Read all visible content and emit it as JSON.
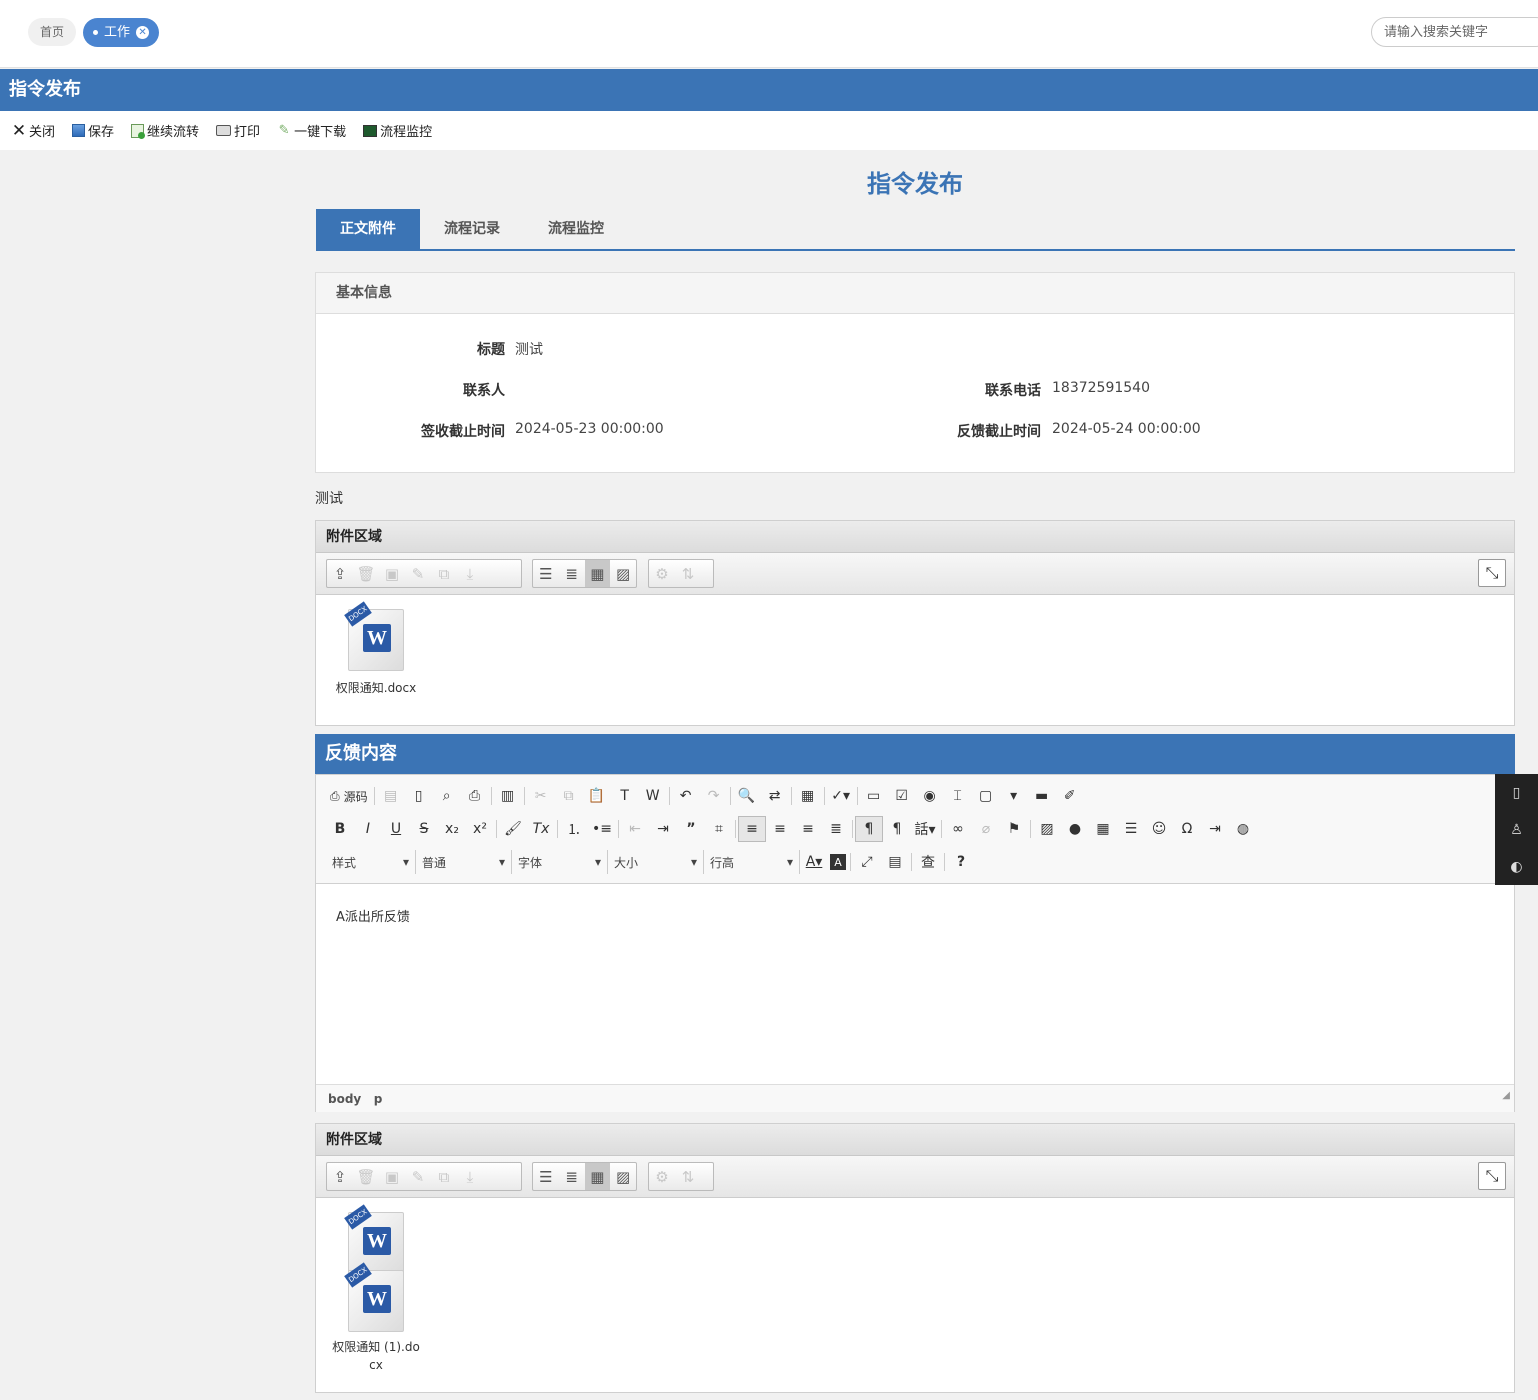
{
  "top_tabs": {
    "home": "首页",
    "work": "工作"
  },
  "search": {
    "placeholder": "请输入搜索关键字"
  },
  "header_title": "指令发布",
  "toolbar": {
    "close": "关闭",
    "save": "保存",
    "continue": "继续流转",
    "print": "打印",
    "download": "一键下载",
    "monitor": "流程监控"
  },
  "page_title": "指令发布",
  "tabs": [
    "正文附件",
    "流程记录",
    "流程监控"
  ],
  "basic": {
    "header": "基本信息",
    "title_label": "标题",
    "title_value": "测试",
    "contact_label": "联系人",
    "contact_value": "",
    "phone_label": "联系电话",
    "phone_value": "18372591540",
    "sign_deadline_label": "签收截止时间",
    "sign_deadline_value": "2024-05-23 00:00:00",
    "feedback_deadline_label": "反馈截止时间",
    "feedback_deadline_value": "2024-05-24 00:00:00"
  },
  "body_text": "测试",
  "attach1": {
    "header": "附件区域",
    "files": [
      "权限通知.docx"
    ]
  },
  "feedback": {
    "header": "反馈内容",
    "content": "A派出所反馈",
    "source_btn": "源码"
  },
  "editor": {
    "style": "样式",
    "format": "普通",
    "font": "字体",
    "size": "大小",
    "line_height": "行高",
    "path_body": "body",
    "path_p": "p"
  },
  "attach2": {
    "header": "附件区域",
    "file_line1": "权限通知 (1).do",
    "file_line2": "cx"
  },
  "colors": {
    "primary": "#3b74b5",
    "tab_active": "#4a84d0"
  }
}
